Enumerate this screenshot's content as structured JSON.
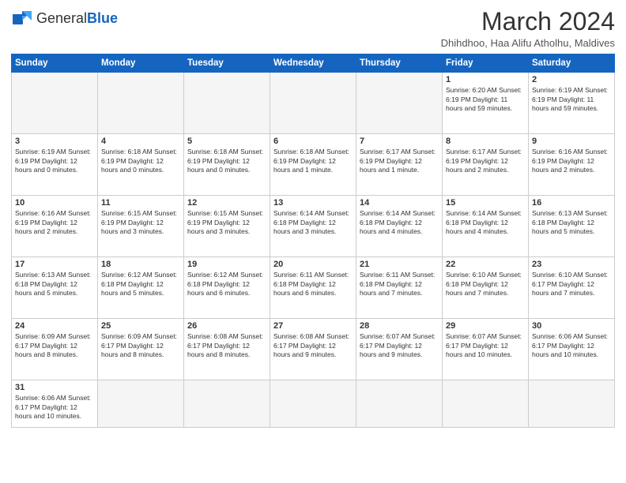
{
  "header": {
    "logo_general": "General",
    "logo_blue": "Blue",
    "month_year": "March 2024",
    "location": "Dhihdhoo, Haa Alifu Atholhu, Maldives"
  },
  "days_of_week": [
    "Sunday",
    "Monday",
    "Tuesday",
    "Wednesday",
    "Thursday",
    "Friday",
    "Saturday"
  ],
  "weeks": [
    [
      {
        "day": "",
        "info": "",
        "empty": true
      },
      {
        "day": "",
        "info": "",
        "empty": true
      },
      {
        "day": "",
        "info": "",
        "empty": true
      },
      {
        "day": "",
        "info": "",
        "empty": true
      },
      {
        "day": "",
        "info": "",
        "empty": true
      },
      {
        "day": "1",
        "info": "Sunrise: 6:20 AM\nSunset: 6:19 PM\nDaylight: 11 hours and 59 minutes."
      },
      {
        "day": "2",
        "info": "Sunrise: 6:19 AM\nSunset: 6:19 PM\nDaylight: 11 hours and 59 minutes."
      }
    ],
    [
      {
        "day": "3",
        "info": "Sunrise: 6:19 AM\nSunset: 6:19 PM\nDaylight: 12 hours and 0 minutes."
      },
      {
        "day": "4",
        "info": "Sunrise: 6:18 AM\nSunset: 6:19 PM\nDaylight: 12 hours and 0 minutes."
      },
      {
        "day": "5",
        "info": "Sunrise: 6:18 AM\nSunset: 6:19 PM\nDaylight: 12 hours and 0 minutes."
      },
      {
        "day": "6",
        "info": "Sunrise: 6:18 AM\nSunset: 6:19 PM\nDaylight: 12 hours and 1 minute."
      },
      {
        "day": "7",
        "info": "Sunrise: 6:17 AM\nSunset: 6:19 PM\nDaylight: 12 hours and 1 minute."
      },
      {
        "day": "8",
        "info": "Sunrise: 6:17 AM\nSunset: 6:19 PM\nDaylight: 12 hours and 2 minutes."
      },
      {
        "day": "9",
        "info": "Sunrise: 6:16 AM\nSunset: 6:19 PM\nDaylight: 12 hours and 2 minutes."
      }
    ],
    [
      {
        "day": "10",
        "info": "Sunrise: 6:16 AM\nSunset: 6:19 PM\nDaylight: 12 hours and 2 minutes."
      },
      {
        "day": "11",
        "info": "Sunrise: 6:15 AM\nSunset: 6:19 PM\nDaylight: 12 hours and 3 minutes."
      },
      {
        "day": "12",
        "info": "Sunrise: 6:15 AM\nSunset: 6:19 PM\nDaylight: 12 hours and 3 minutes."
      },
      {
        "day": "13",
        "info": "Sunrise: 6:14 AM\nSunset: 6:18 PM\nDaylight: 12 hours and 3 minutes."
      },
      {
        "day": "14",
        "info": "Sunrise: 6:14 AM\nSunset: 6:18 PM\nDaylight: 12 hours and 4 minutes."
      },
      {
        "day": "15",
        "info": "Sunrise: 6:14 AM\nSunset: 6:18 PM\nDaylight: 12 hours and 4 minutes."
      },
      {
        "day": "16",
        "info": "Sunrise: 6:13 AM\nSunset: 6:18 PM\nDaylight: 12 hours and 5 minutes."
      }
    ],
    [
      {
        "day": "17",
        "info": "Sunrise: 6:13 AM\nSunset: 6:18 PM\nDaylight: 12 hours and 5 minutes."
      },
      {
        "day": "18",
        "info": "Sunrise: 6:12 AM\nSunset: 6:18 PM\nDaylight: 12 hours and 5 minutes."
      },
      {
        "day": "19",
        "info": "Sunrise: 6:12 AM\nSunset: 6:18 PM\nDaylight: 12 hours and 6 minutes."
      },
      {
        "day": "20",
        "info": "Sunrise: 6:11 AM\nSunset: 6:18 PM\nDaylight: 12 hours and 6 minutes."
      },
      {
        "day": "21",
        "info": "Sunrise: 6:11 AM\nSunset: 6:18 PM\nDaylight: 12 hours and 7 minutes."
      },
      {
        "day": "22",
        "info": "Sunrise: 6:10 AM\nSunset: 6:18 PM\nDaylight: 12 hours and 7 minutes."
      },
      {
        "day": "23",
        "info": "Sunrise: 6:10 AM\nSunset: 6:17 PM\nDaylight: 12 hours and 7 minutes."
      }
    ],
    [
      {
        "day": "24",
        "info": "Sunrise: 6:09 AM\nSunset: 6:17 PM\nDaylight: 12 hours and 8 minutes."
      },
      {
        "day": "25",
        "info": "Sunrise: 6:09 AM\nSunset: 6:17 PM\nDaylight: 12 hours and 8 minutes."
      },
      {
        "day": "26",
        "info": "Sunrise: 6:08 AM\nSunset: 6:17 PM\nDaylight: 12 hours and 8 minutes."
      },
      {
        "day": "27",
        "info": "Sunrise: 6:08 AM\nSunset: 6:17 PM\nDaylight: 12 hours and 9 minutes."
      },
      {
        "day": "28",
        "info": "Sunrise: 6:07 AM\nSunset: 6:17 PM\nDaylight: 12 hours and 9 minutes."
      },
      {
        "day": "29",
        "info": "Sunrise: 6:07 AM\nSunset: 6:17 PM\nDaylight: 12 hours and 10 minutes."
      },
      {
        "day": "30",
        "info": "Sunrise: 6:06 AM\nSunset: 6:17 PM\nDaylight: 12 hours and 10 minutes."
      }
    ],
    [
      {
        "day": "31",
        "info": "Sunrise: 6:06 AM\nSunset: 6:17 PM\nDaylight: 12 hours and 10 minutes.",
        "last": true
      },
      {
        "day": "",
        "info": "",
        "empty": true,
        "last": true
      },
      {
        "day": "",
        "info": "",
        "empty": true,
        "last": true
      },
      {
        "day": "",
        "info": "",
        "empty": true,
        "last": true
      },
      {
        "day": "",
        "info": "",
        "empty": true,
        "last": true
      },
      {
        "day": "",
        "info": "",
        "empty": true,
        "last": true
      },
      {
        "day": "",
        "info": "",
        "empty": true,
        "last": true
      }
    ]
  ]
}
